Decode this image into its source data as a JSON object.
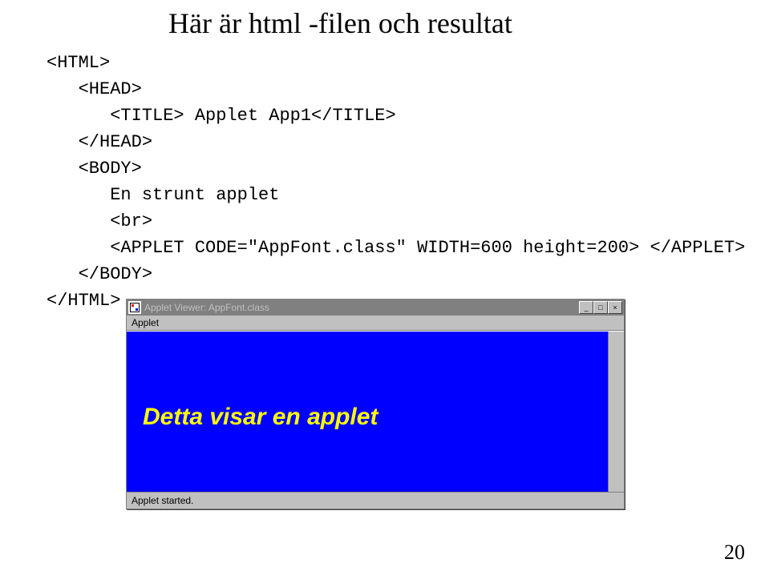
{
  "title": "Här är html -filen och resultat",
  "code": {
    "l1": "<HTML>",
    "l2": "   <HEAD>",
    "l3": "      <TITLE> Applet App1</TITLE>",
    "l4": "   </HEAD>",
    "l5": "   <BODY>",
    "l6": "      En strunt applet",
    "l7": "      <br>",
    "l8": "      <APPLET CODE=\"AppFont.class\" WIDTH=600 height=200> </APPLET>",
    "l9": "   </BODY>",
    "l10": "</HTML>"
  },
  "window": {
    "title": "Applet Viewer: AppFont.class",
    "menu": "Applet",
    "applet_text": "Detta visar en applet",
    "status": "Applet started."
  },
  "buttons": {
    "min": "_",
    "max": "□",
    "close": "×"
  },
  "page_number": "20"
}
